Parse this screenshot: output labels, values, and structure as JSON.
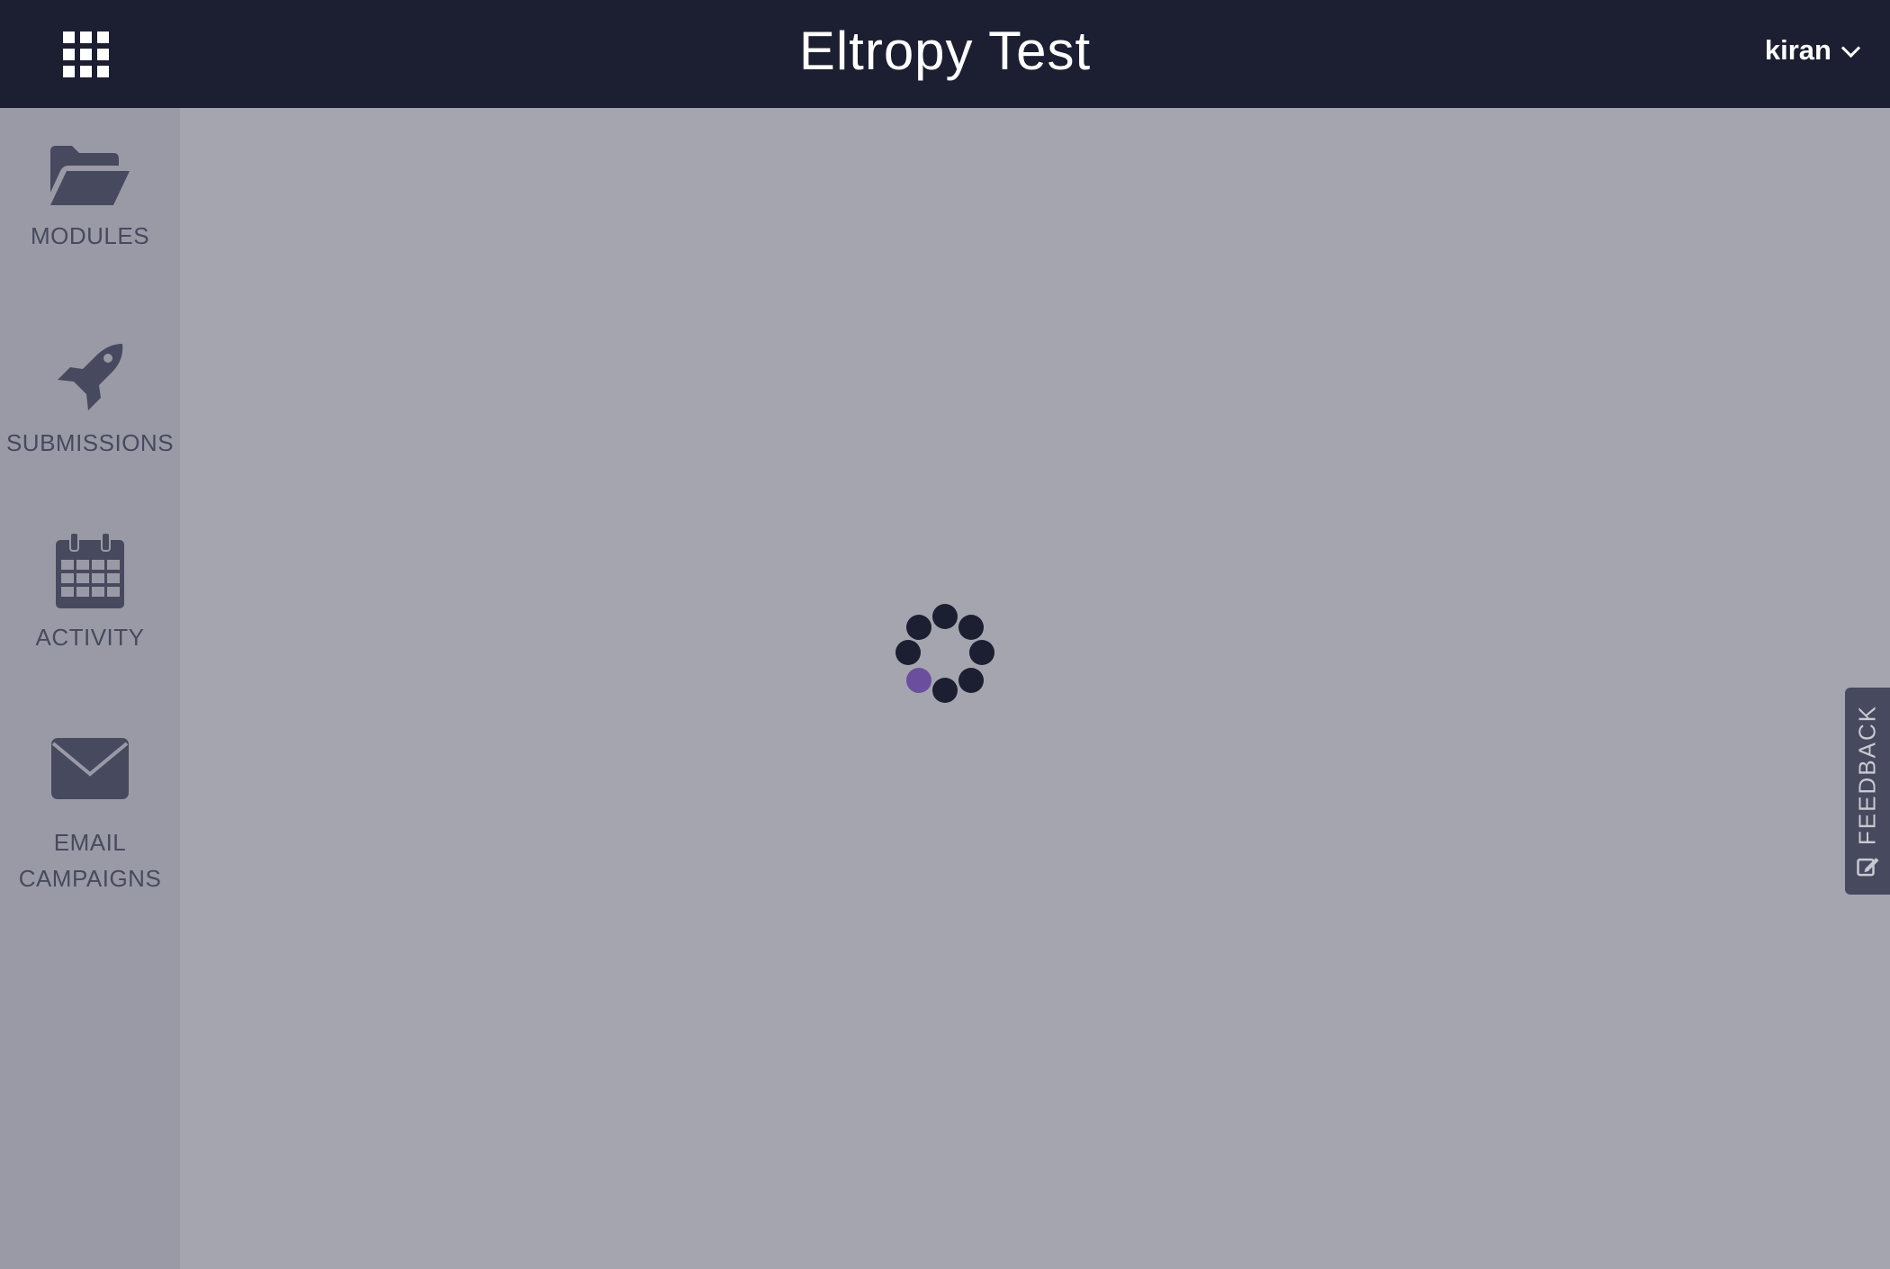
{
  "header": {
    "title": "Eltropy Test",
    "user_name": "kiran",
    "apps_icon": "apps-grid-icon",
    "user_menu_icon": "chevron-down-icon"
  },
  "sidebar": {
    "items": [
      {
        "label": "MODULES",
        "icon": "folder-open-icon"
      },
      {
        "label": "SUBMISSIONS",
        "icon": "rocket-icon"
      },
      {
        "label": "ACTIVITY",
        "icon": "calendar-icon"
      },
      {
        "label_line1": "EMAIL",
        "label_line2": "CAMPAIGNS",
        "icon": "envelope-icon"
      }
    ]
  },
  "feedback": {
    "label": "FEEDBACK",
    "icon": "edit-icon"
  },
  "loading": {
    "icon": "loading-spinner-icon",
    "active_dot_color": "#6b4f9e",
    "dot_color": "#1c1e31"
  },
  "colors": {
    "header_bg": "#1c1e31",
    "sidebar_bg": "#9a9aa7",
    "content_bg": "#a5a5b0",
    "sidebar_text": "#474a5e",
    "feedback_bg": "#474a5e"
  }
}
